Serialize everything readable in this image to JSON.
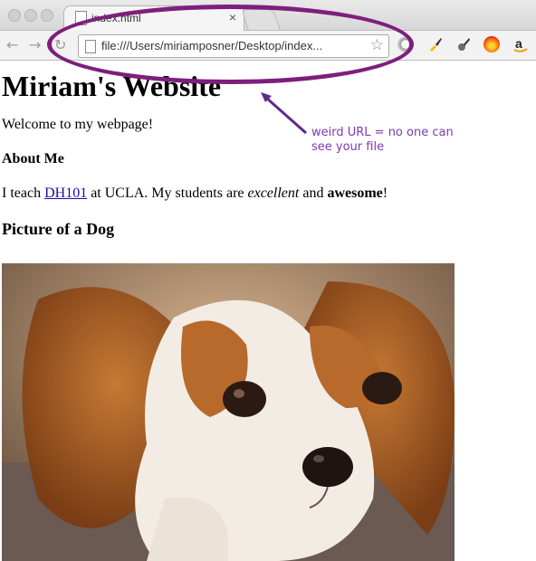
{
  "browser": {
    "tab_title": "index.html",
    "tab_close": "×",
    "url": "file:///Users/miriamposner/Desktop/index...",
    "back_glyph": "←",
    "forward_glyph": "→",
    "reload_glyph": "↻",
    "star_glyph": "☆"
  },
  "annotation": {
    "note": "weird URL = no one can see your file",
    "color": "#7d1f7c"
  },
  "page": {
    "title": "Miriam's Website",
    "welcome": "Welcome to my webpage!",
    "about_heading": "About Me",
    "teach_prefix": "I teach ",
    "teach_link": "DH101",
    "teach_middle": " at UCLA. My students are ",
    "teach_em": "excellent",
    "teach_and": " and ",
    "teach_strong": "awesome",
    "teach_suffix": "!",
    "dog_heading": "Picture of a Dog"
  },
  "image": {
    "subject": "puppy-photo"
  },
  "icons": [
    "document-icon",
    "star-icon",
    "extension-icons"
  ]
}
